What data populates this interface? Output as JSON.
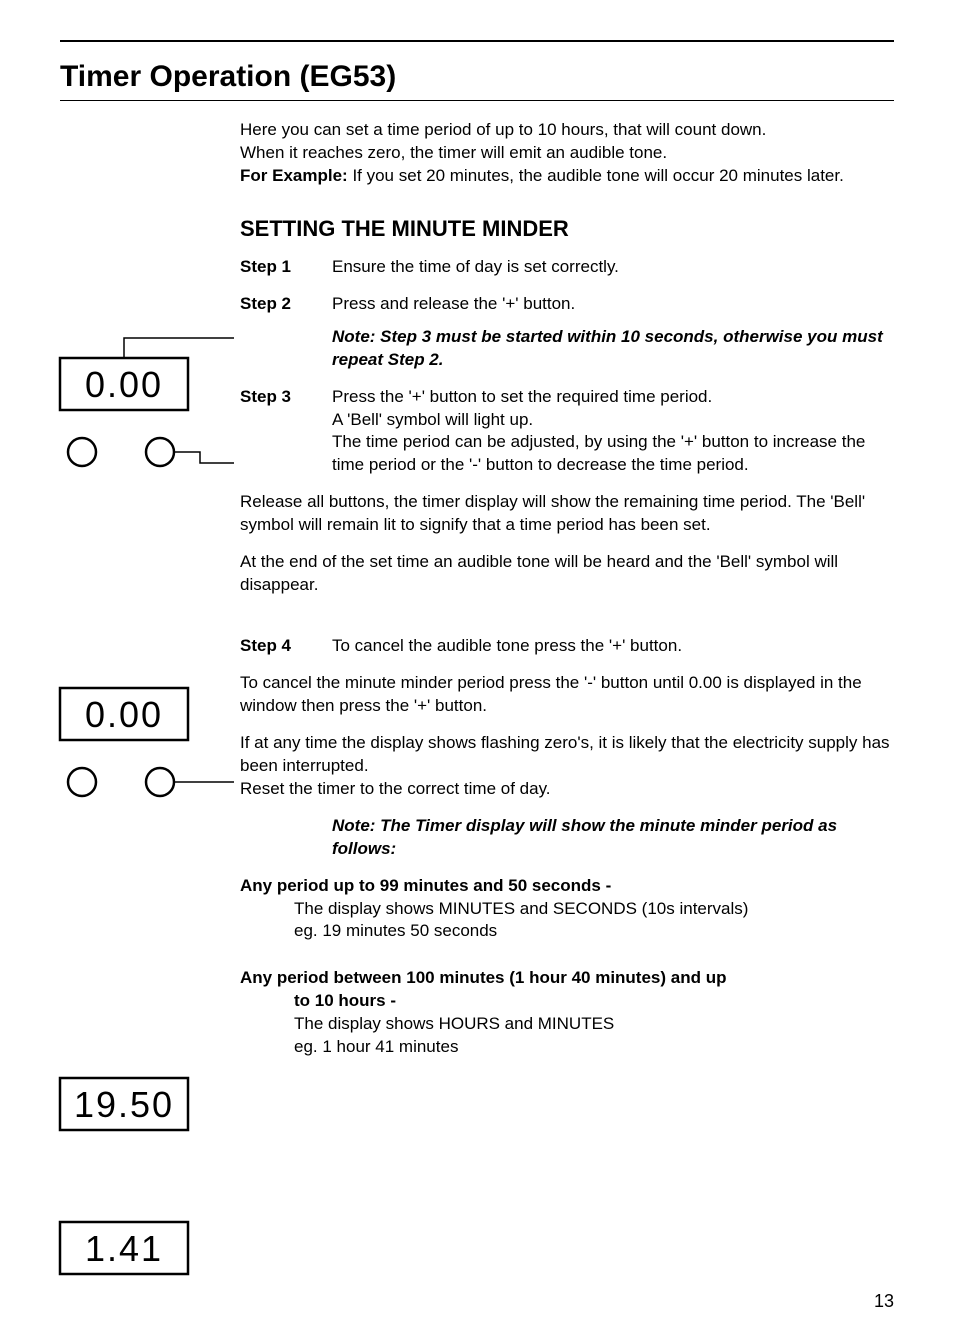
{
  "title": "Timer Operation (EG53)",
  "intro": {
    "line1": "Here you can set a time period of up to 10 hours, that will count down.",
    "line2": "When it reaches zero, the timer will emit an audible tone.",
    "example_label": "For Example:",
    "example_text": "If you set 20 minutes, the audible tone will occur 20 minutes later."
  },
  "section_heading": "SETTING THE MINUTE MINDER",
  "steps": {
    "s1": {
      "label": "Step 1",
      "text": "Ensure the time of day is set correctly."
    },
    "s2": {
      "label": "Step 2",
      "text": "Press and release the '+' button.",
      "note": "Note: Step 3 must be started within 10 seconds, otherwise you must repeat Step 2."
    },
    "s3": {
      "label": "Step 3",
      "l1": "Press the '+' button to set the required time period.",
      "l2": "A 'Bell' symbol will light up.",
      "l3": "The time period can be adjusted, by using the '+' button to increase the time period or the '-' button to decrease the time period."
    },
    "release": "Release all buttons, the timer display will show the remaining time period. The 'Bell' symbol will remain lit to signify that a time period has been set.",
    "end": "At the end of the set time an audible tone will be heard and the 'Bell' symbol will disappear.",
    "s4": {
      "label": "Step 4",
      "text": "To cancel the audible tone press the '+' button."
    },
    "cancel": "To cancel the minute minder period press the '-' button until 0.00 is displayed in the window then press the '+' button.",
    "flashing": {
      "l1": "If at any time the display shows flashing zero's, it is likely that the electricity supply has been interrupted.",
      "l2": "Reset the timer to the correct time of day."
    },
    "display_note": "Note: The Timer display will show the minute minder period as follows:",
    "period1": {
      "head": "Any period up to 99 minutes and 50 seconds -",
      "l1": "The display shows MINUTES and SECONDS (10s intervals)",
      "l2": "eg. 19 minutes 50 seconds"
    },
    "period2": {
      "head": "Any period between 100 minutes (1 hour 40 minutes) and up to 10 hours -",
      "l1": "The display shows HOURS and MINUTES",
      "l2": "eg. 1 hour 41 minutes"
    }
  },
  "displays": {
    "d1": "0.00",
    "d2": "0.00",
    "d3": "19.50",
    "d4": "1.41"
  },
  "page_number": "13"
}
